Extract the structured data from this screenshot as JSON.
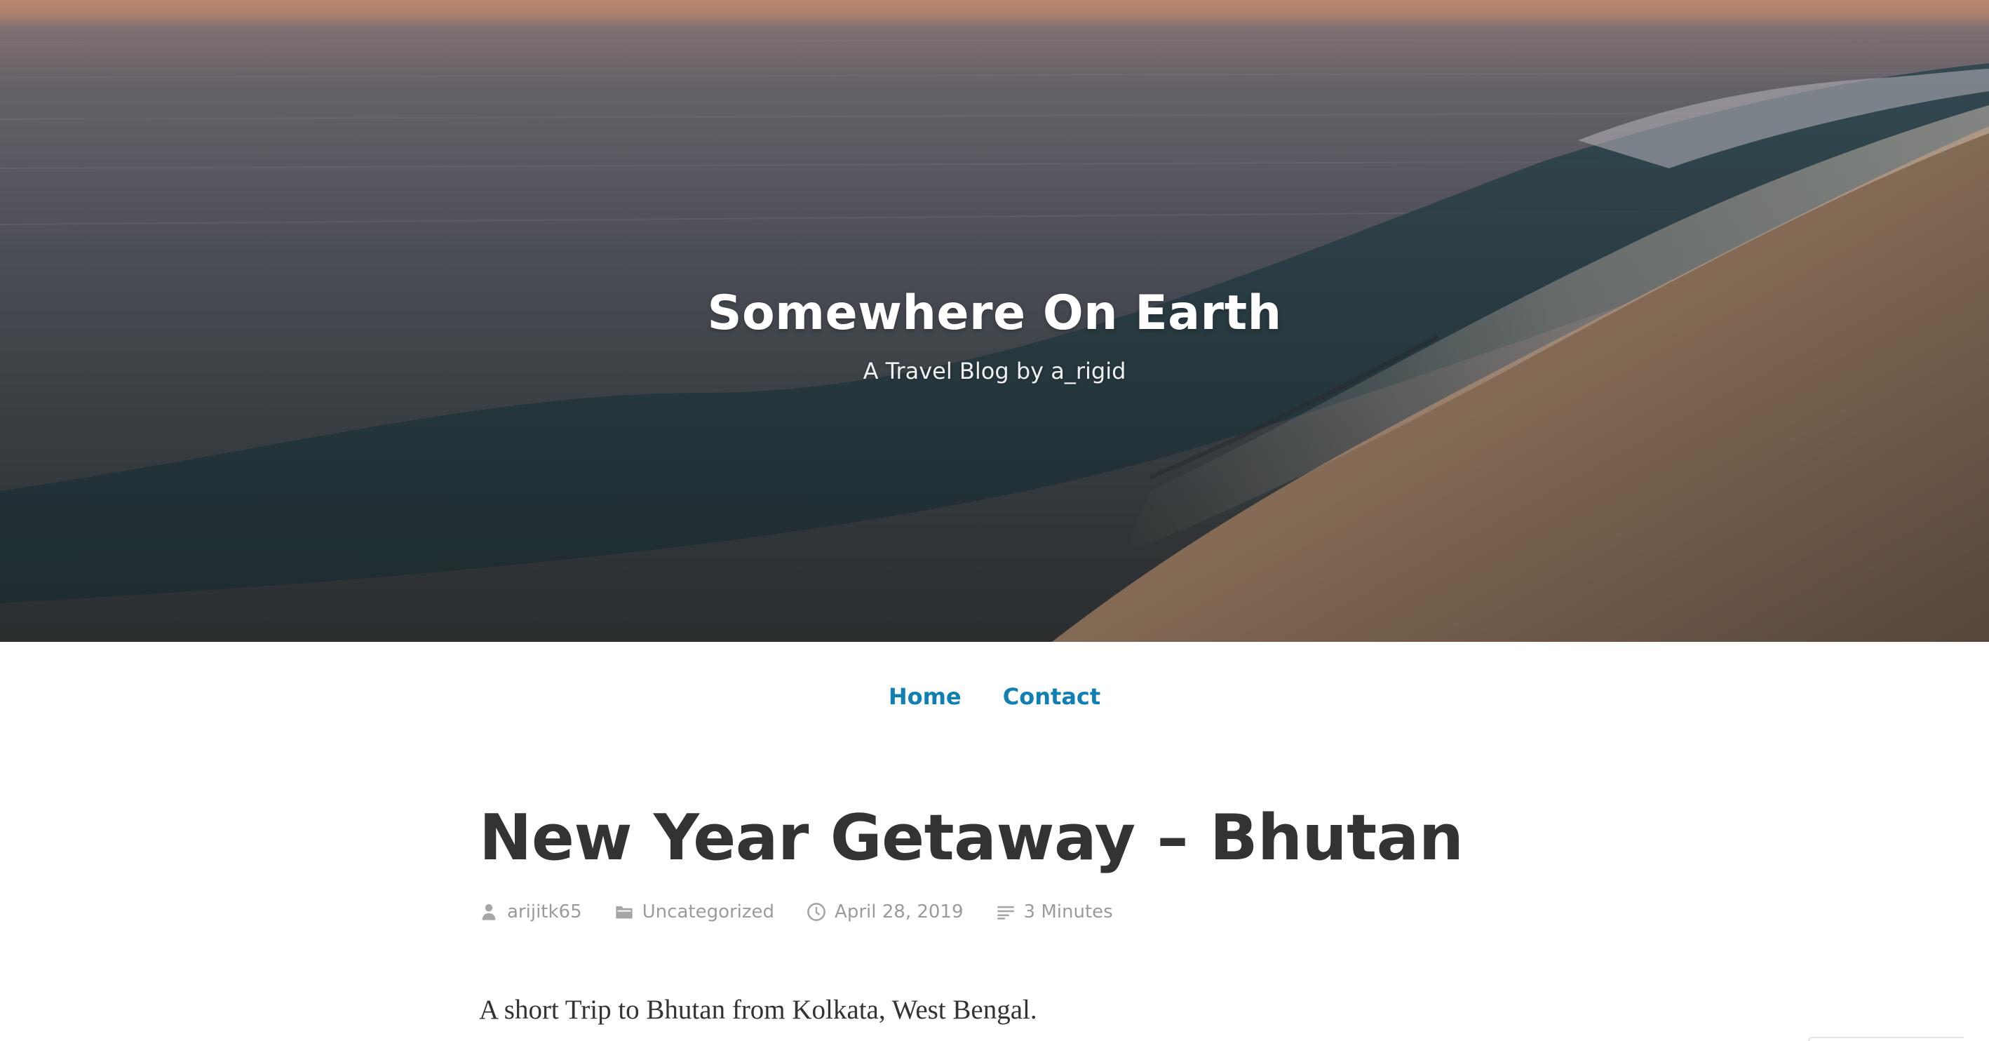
{
  "colors": {
    "nav_link": "#0f7fb4",
    "title_text": "#333333",
    "meta_text": "#9b9b9b",
    "hero_sky": "#c99379",
    "hero_water": "#4c5058",
    "hero_sand": "#8a6f5a"
  },
  "header": {
    "site_title": "Somewhere On Earth",
    "site_description": "A Travel Blog by a_rigid"
  },
  "nav": {
    "items": [
      {
        "label": "Home"
      },
      {
        "label": "Contact"
      }
    ]
  },
  "post": {
    "title": "New Year Getaway – Bhutan",
    "meta": {
      "author": "arijitk65",
      "author_icon": "user-icon",
      "category": "Uncategorized",
      "category_icon": "folder-icon",
      "date": "April 28, 2019",
      "date_icon": "clock-icon",
      "reading_time": "3 Minutes",
      "reading_time_icon": "lines-icon"
    },
    "excerpt": "A short Trip to Bhutan from Kolkata, West Bengal."
  }
}
